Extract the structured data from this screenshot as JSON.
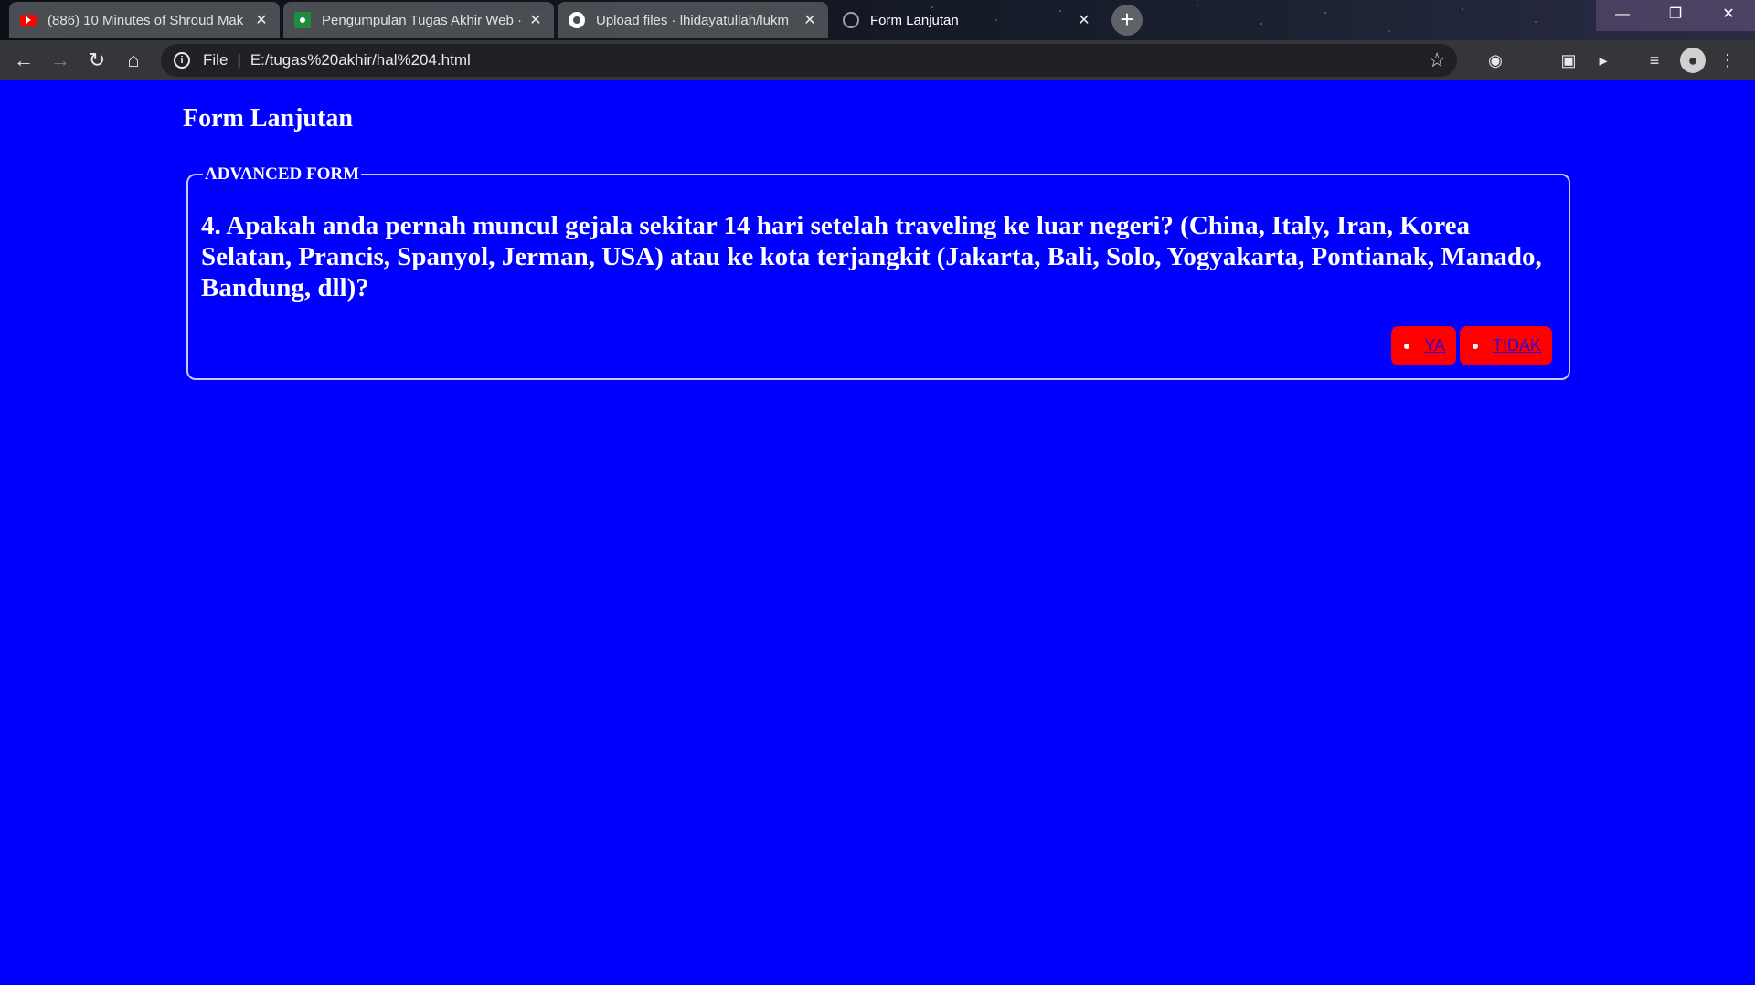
{
  "browser": {
    "tabs": [
      {
        "title": "(886) 10 Minutes of Shroud Mak",
        "icon": "youtube-icon",
        "active": false
      },
      {
        "title": "Pengumpulan Tugas Akhir Web ·",
        "icon": "classroom-icon",
        "active": false
      },
      {
        "title": "Upload files · lhidayatullah/lukm",
        "icon": "github-icon",
        "active": false
      },
      {
        "title": "Form Lanjutan",
        "icon": "globe-icon",
        "active": true
      }
    ],
    "address": {
      "scheme_label": "File",
      "url": "E:/tugas%20akhir/hal%204.html"
    }
  },
  "page": {
    "heading": "Form Lanjutan",
    "form": {
      "legend": "ADVANCED FORM",
      "question": "4. Apakah anda pernah muncul gejala sekitar 14 hari setelah traveling ke luar negeri? (China, Italy, Iran, Korea Selatan, Prancis, Spanyol, Jerman, USA) atau ke kota terjangkit (Jakarta, Bali, Solo, Yogyakarta, Pontianak, Manado, Bandung, dll)?",
      "answers": {
        "yes": "YA",
        "no": "TIDAK"
      }
    }
  },
  "colors": {
    "page_background": "#0000ff",
    "answer_button": "#ff0000",
    "link": "#3300cc"
  }
}
